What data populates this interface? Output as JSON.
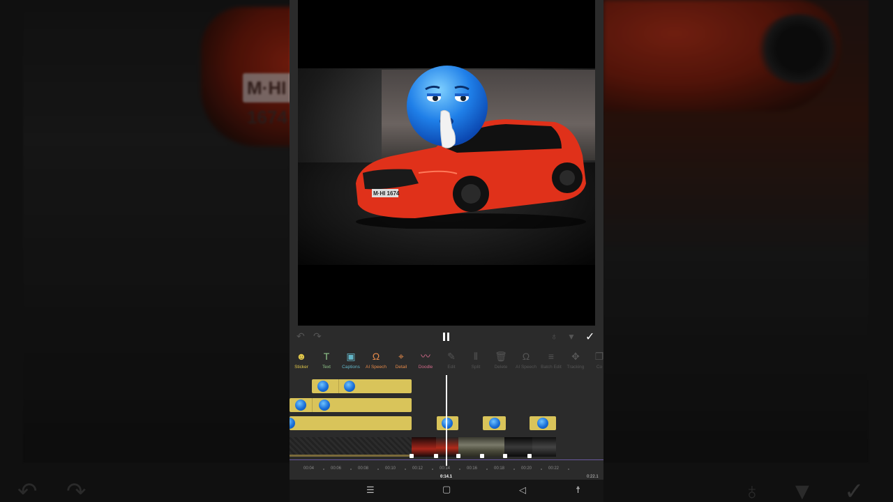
{
  "background": {
    "plate_text": "M·HI 1674"
  },
  "preview": {
    "car_plate": "M·HI 1674"
  },
  "controls": {
    "undo_icon": "undo-icon",
    "redo_icon": "redo-icon",
    "pause_icon": "pause-icon",
    "keyframe_icon": "keyframe-icon",
    "confirm_icon": "check-icon"
  },
  "toolbar": [
    {
      "label": "Sticker",
      "icon": "sticker-icon",
      "glyph": "☻",
      "color": "#e2c84a",
      "active": true
    },
    {
      "label": "Text",
      "icon": "text-icon",
      "glyph": "T",
      "color": "#8fc48a",
      "active": true
    },
    {
      "label": "Captions",
      "icon": "captions-icon",
      "glyph": "▣",
      "color": "#63b6c8",
      "active": true
    },
    {
      "label": "AI Speech",
      "icon": "ai-speech-icon",
      "glyph": "Ω",
      "color": "#e58a4a",
      "active": true
    },
    {
      "label": "Detail",
      "icon": "detail-icon",
      "glyph": "⌖",
      "color": "#e58a4a",
      "active": true
    },
    {
      "label": "Doodle",
      "icon": "doodle-icon",
      "glyph": "〰",
      "color": "#d26a8a",
      "active": true
    },
    {
      "label": "Edit",
      "icon": "edit-icon",
      "glyph": "✎",
      "color": "#555",
      "active": false
    },
    {
      "label": "Split",
      "icon": "split-icon",
      "glyph": "⫴",
      "color": "#555",
      "active": false
    },
    {
      "label": "Delete",
      "icon": "delete-icon",
      "glyph": "🗑",
      "color": "#555",
      "active": false
    },
    {
      "label": "AI Speech",
      "icon": "ai-speech-disabled-icon",
      "glyph": "Ω",
      "color": "#555",
      "active": false
    },
    {
      "label": "Batch Edit",
      "icon": "batch-edit-icon",
      "glyph": "≡",
      "color": "#555",
      "active": false
    },
    {
      "label": "Tracking",
      "icon": "tracking-icon",
      "glyph": "✥",
      "color": "#555",
      "active": false
    },
    {
      "label": "Co",
      "icon": "copy-icon",
      "glyph": "❐",
      "color": "#555",
      "active": false
    }
  ],
  "timeline": {
    "ticks": [
      "00:04",
      "00:06",
      "00:08",
      "00:10",
      "00:12",
      "00:14",
      "00:16",
      "00:18",
      "00:20",
      "00:22"
    ],
    "current_time": "0:14.1",
    "duration": "0:22.1"
  },
  "navbar": {
    "menu_icon": "recent-apps-icon",
    "home_icon": "home-icon",
    "back_icon": "back-icon",
    "accessibility_icon": "accessibility-icon"
  }
}
